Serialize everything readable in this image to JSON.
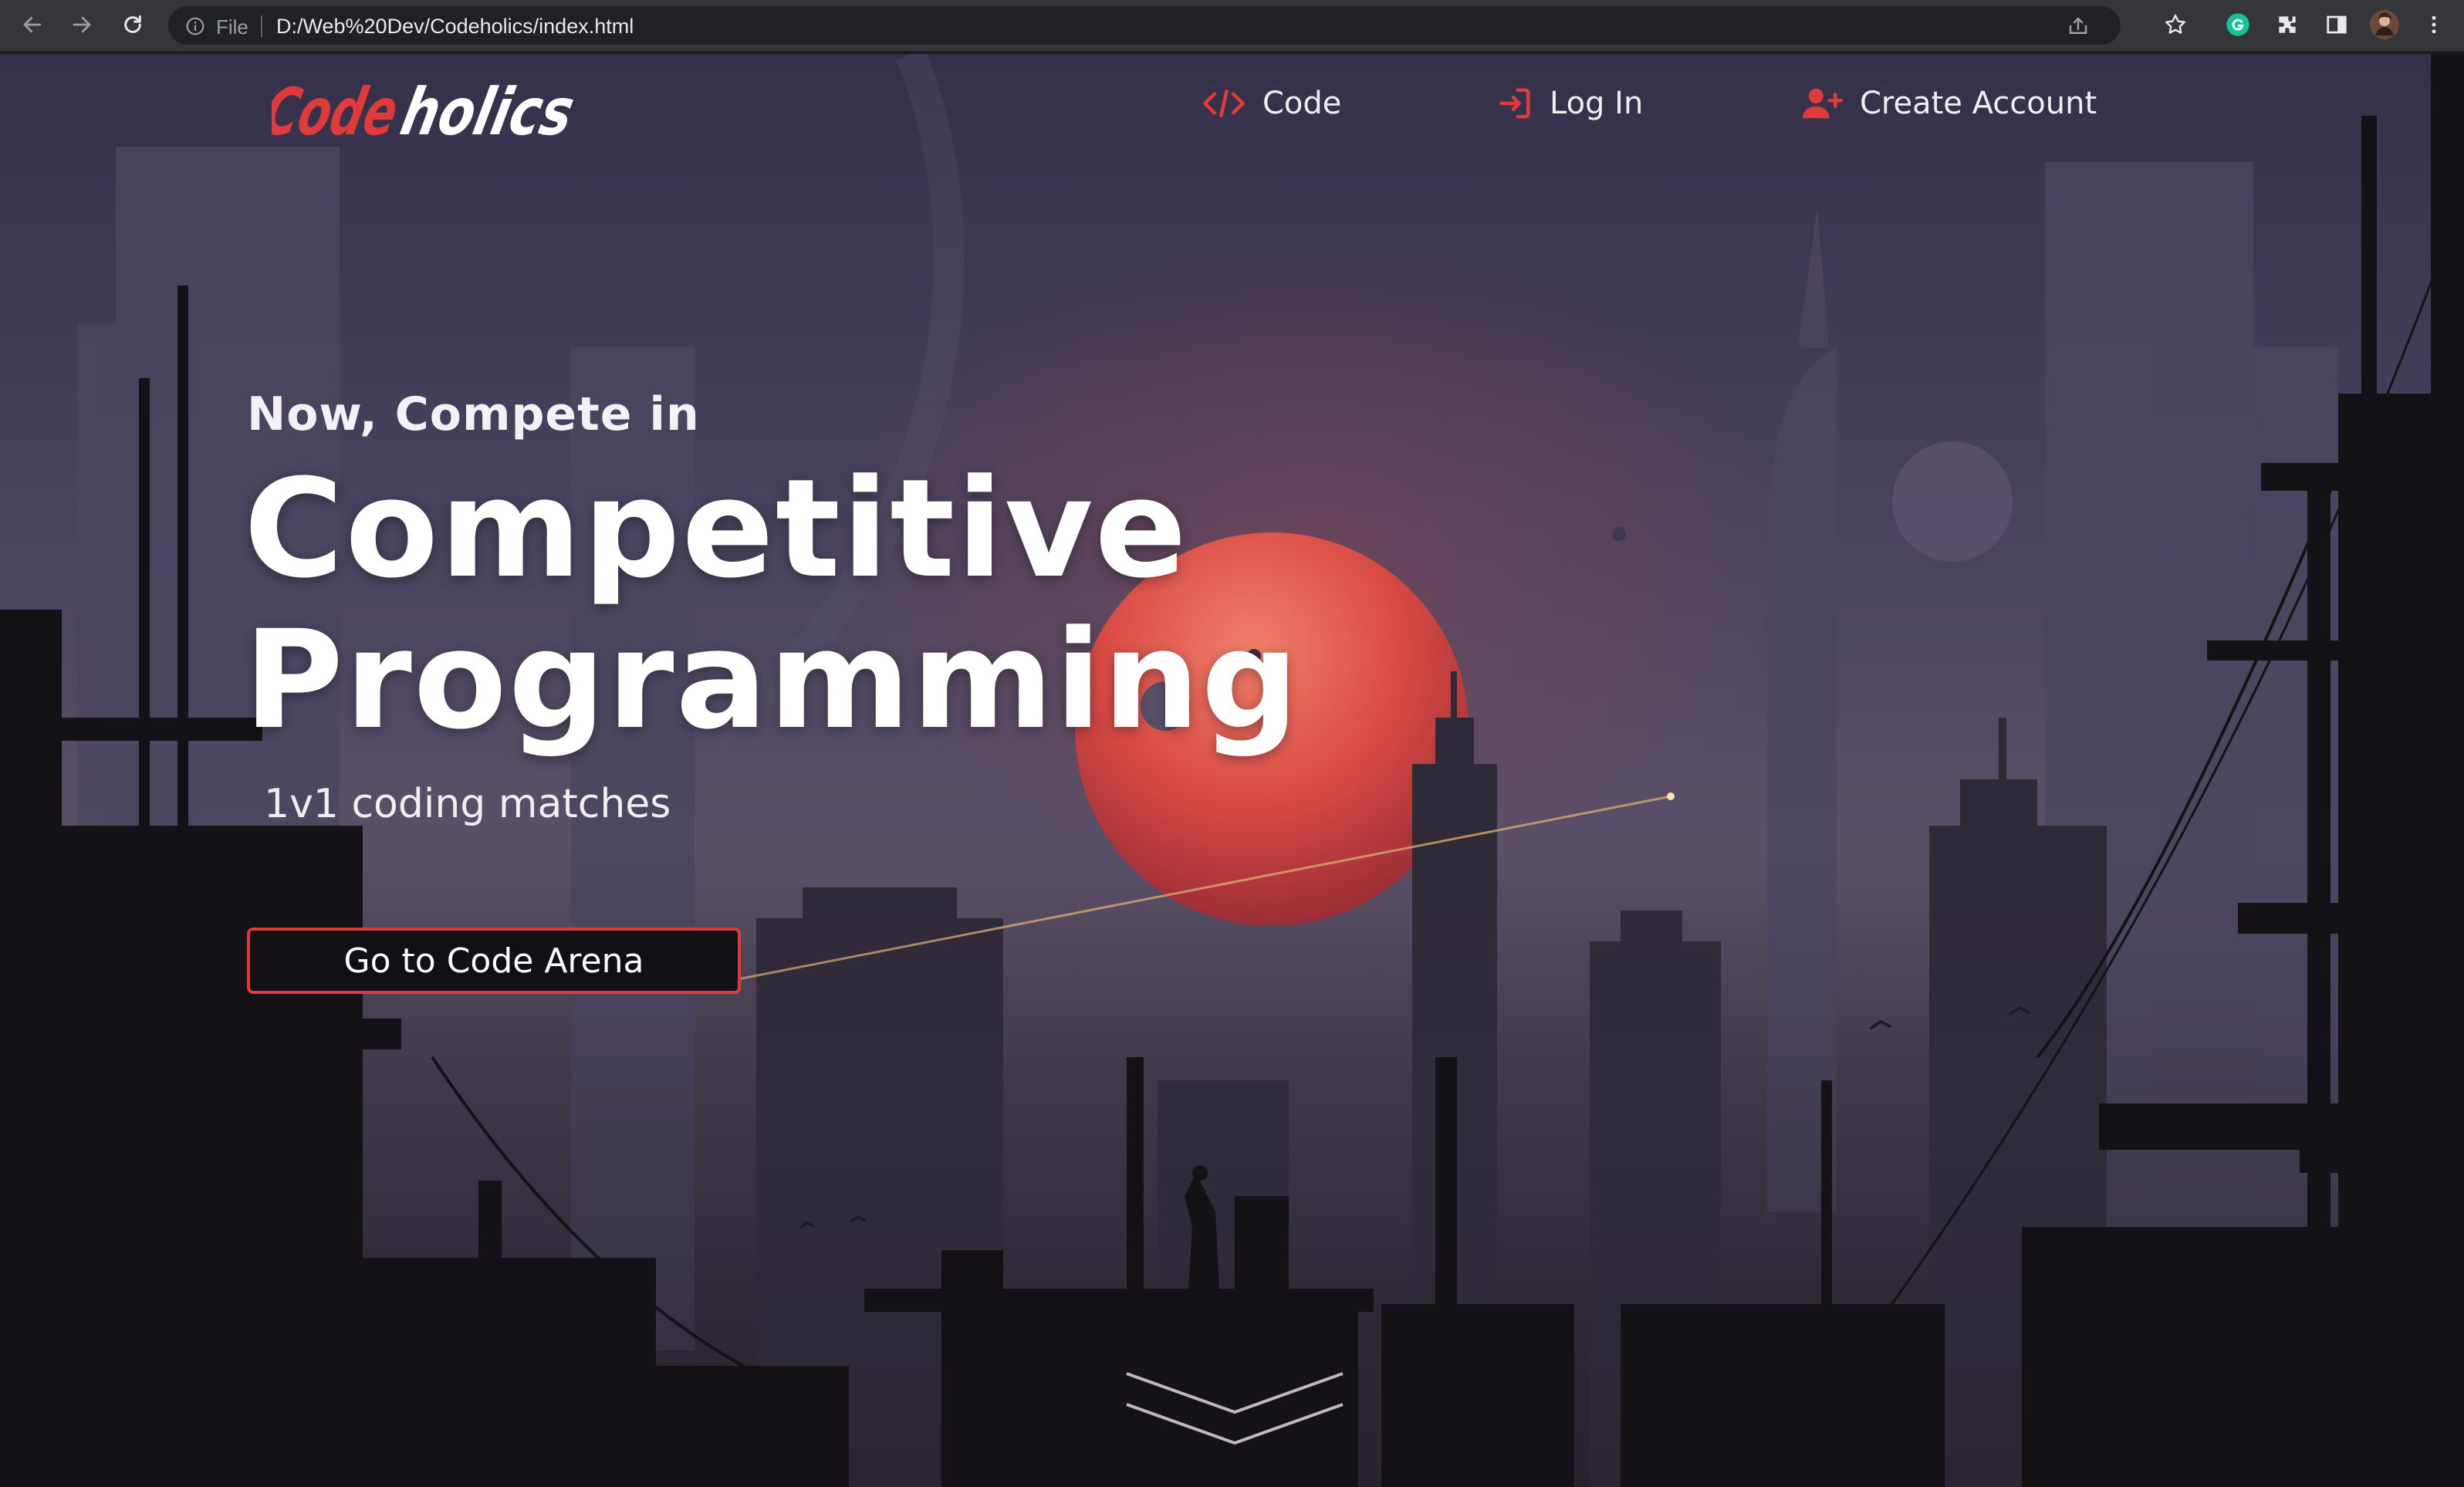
{
  "browser": {
    "scheme_label": "File",
    "url": "D:/Web%20Dev/Codeholics/index.html",
    "icons": [
      "back-arrow-icon",
      "forward-arrow-icon",
      "reload-icon",
      "info-icon",
      "share-icon",
      "star-icon",
      "grammarly-icon",
      "extensions-icon",
      "side-panel-icon",
      "profile-avatar",
      "kebab-menu-icon"
    ]
  },
  "site": {
    "logo_text": "Codeholics",
    "brand_colors": {
      "accent": "#e03a3a",
      "text": "#ffffff"
    },
    "nav": [
      {
        "label": "Code",
        "icon": "code-icon"
      },
      {
        "label": "Log In",
        "icon": "login-icon"
      },
      {
        "label": "Create Account",
        "icon": "add-user-icon"
      }
    ]
  },
  "hero": {
    "pre_title": "Now, Compete in",
    "title_line1": "Competitive",
    "title_line2": "Programming",
    "subtitle": "1v1 coding matches",
    "cta_label": "Go to Code Arena",
    "scroll_icon": "chevron-down-icon"
  }
}
